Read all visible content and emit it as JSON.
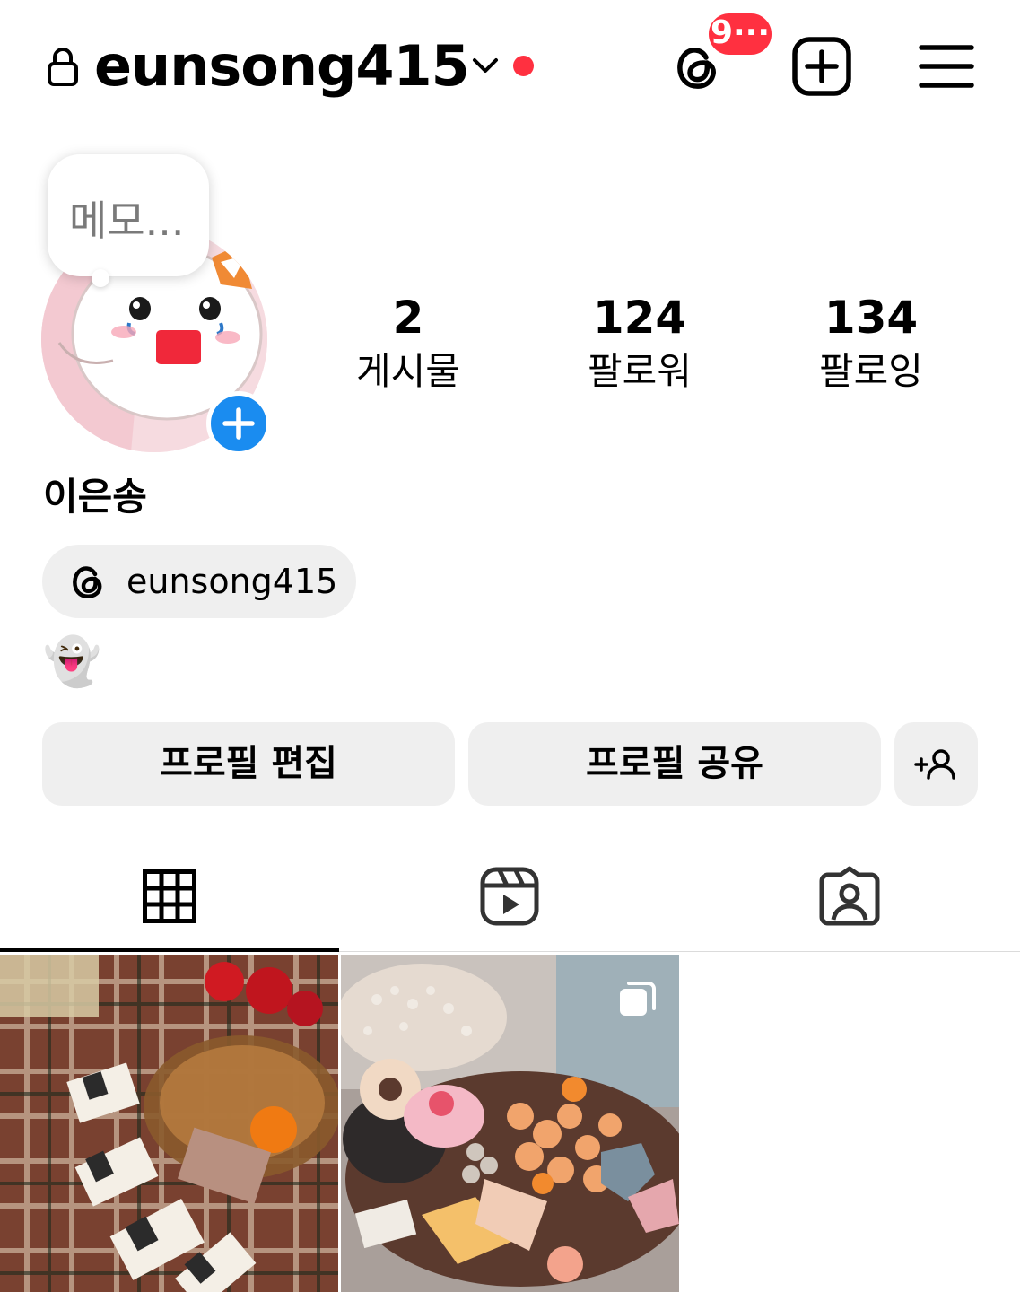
{
  "header": {
    "username": "eunsong415",
    "notification_count": "9···",
    "icons": [
      "lock-icon",
      "chevron-down-icon",
      "threads-icon",
      "add-post-icon",
      "menu-icon"
    ]
  },
  "note": {
    "text": "메모..."
  },
  "stats": {
    "posts": {
      "count": "2",
      "label": "게시물"
    },
    "followers": {
      "count": "124",
      "label": "팔로워"
    },
    "following": {
      "count": "134",
      "label": "팔로잉"
    }
  },
  "profile": {
    "name": "이은송",
    "threads_handle": "eunsong415",
    "bio": "👻"
  },
  "buttons": {
    "edit_profile": "프로필 편집",
    "share_profile": "프로필 공유"
  },
  "tabs": [
    "posts-grid-icon",
    "reels-icon",
    "tagged-icon"
  ],
  "colors": {
    "accent_red": "#ff3040",
    "accent_blue": "#1a8cf0",
    "button_bg": "#efefef"
  }
}
